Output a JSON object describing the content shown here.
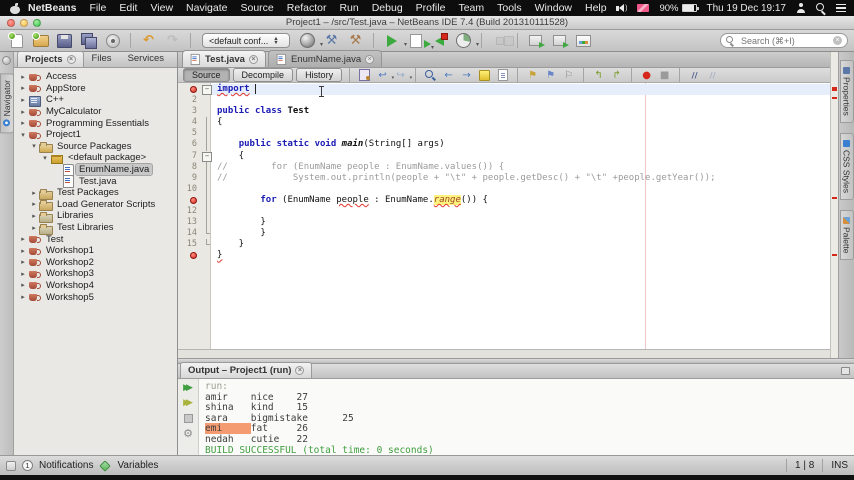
{
  "colors": {
    "error_red": "#e1352b",
    "error_highlight_yellow": "#fdf27b",
    "success_green": "#3f9e3f",
    "output_match_orange": "#f49b72",
    "keyword_blue": "#1a1ab5",
    "comment_gray": "#9b9b9b"
  },
  "menubar": {
    "items": [
      "NetBeans",
      "File",
      "Edit",
      "View",
      "Navigate",
      "Source",
      "Refactor",
      "Run",
      "Debug",
      "Profile",
      "Team",
      "Tools",
      "Window",
      "Help"
    ],
    "battery_percent": "90%",
    "clock": "Thu 19 Dec 19:17"
  },
  "window": {
    "title": "Project1 – /src/Test.java – NetBeans IDE 7.4 (Build 201310111528)"
  },
  "toolbar": {
    "config_label": "<default conf...",
    "search_placeholder": "Search (⌘+I)",
    "buttons": [
      {
        "name": "new-file",
        "cls": "i-new-file"
      },
      {
        "name": "new-project",
        "cls": "i-new-project"
      },
      {
        "name": "open-project",
        "cls": "i-open-project"
      },
      {
        "name": "save-all",
        "cls": "i-save-all"
      },
      {
        "name": "open-file",
        "cls": "i-open-file"
      },
      {
        "sep": true
      },
      {
        "name": "undo",
        "glyph": "↶",
        "color": "#dd9a2e"
      },
      {
        "name": "redo",
        "glyph": "↷",
        "color": "#bcbcbc"
      },
      {
        "sep": true
      },
      {
        "config": true
      },
      {
        "name": "build-with-dependencies",
        "cls": "i-sphere",
        "dd": true
      },
      {
        "name": "build-project",
        "glyph": "⚒",
        "color": "#5b78a8"
      },
      {
        "name": "clean-and-build",
        "glyph": "⚒",
        "color": "#a8784a"
      },
      {
        "sep": true
      },
      {
        "name": "run-project",
        "cls": "i-run",
        "dd": true
      },
      {
        "name": "debug-project",
        "cls": "i-debug",
        "dd": true
      },
      {
        "name": "apply-code-changes",
        "cls": "i-apply"
      },
      {
        "name": "profile-project",
        "cls": "i-profile",
        "dd": true
      },
      {
        "sep": true
      },
      {
        "name": "profiling-points",
        "cls": "i-ppoints",
        "dis": true
      },
      {
        "sep": true
      },
      {
        "name": "vcs-update",
        "cls": "i-vcs"
      },
      {
        "name": "vcs-commit",
        "cls": "i-vcs"
      },
      {
        "name": "memory-view",
        "cls": "i-mem"
      }
    ]
  },
  "left_rail": {
    "tab": "Navigator"
  },
  "right_rail": {
    "tabs": [
      {
        "label": "Properties",
        "icon": "props"
      },
      {
        "label": "CSS Styles",
        "icon": "css"
      },
      {
        "label": "Palette",
        "icon": "palette"
      }
    ]
  },
  "projects": {
    "tabs": [
      {
        "label": "Projects",
        "active": true,
        "closable": true
      },
      {
        "label": "Files"
      },
      {
        "label": "Services"
      }
    ],
    "tree": [
      {
        "d": 0,
        "a": "c",
        "i": "prj",
        "l": "Access"
      },
      {
        "d": 0,
        "a": "c",
        "i": "prj",
        "l": "AppStore"
      },
      {
        "d": 0,
        "a": "c",
        "i": "cpp",
        "l": "C++"
      },
      {
        "d": 0,
        "a": "c",
        "i": "prj",
        "l": "MyCalculator"
      },
      {
        "d": 0,
        "a": "c",
        "i": "prj",
        "l": "Programming Essentials"
      },
      {
        "d": 0,
        "a": "e",
        "i": "prj",
        "l": "Project1"
      },
      {
        "d": 1,
        "a": "e",
        "i": "src",
        "l": "Source Packages"
      },
      {
        "d": 2,
        "a": "e",
        "i": "pkg",
        "l": "<default package>"
      },
      {
        "d": 3,
        "a": "n",
        "i": "jav",
        "l": "EnumName.java",
        "sel": true
      },
      {
        "d": 3,
        "a": "n",
        "i": "jav",
        "l": "Test.java"
      },
      {
        "d": 1,
        "a": "c",
        "i": "folder",
        "l": "Test Packages"
      },
      {
        "d": 1,
        "a": "c",
        "i": "folder",
        "l": "Load Generator Scripts"
      },
      {
        "d": 1,
        "a": "c",
        "i": "lib",
        "l": "Libraries"
      },
      {
        "d": 1,
        "a": "c",
        "i": "lib",
        "l": "Test Libraries"
      },
      {
        "d": 0,
        "a": "c",
        "i": "prj",
        "l": "Test"
      },
      {
        "d": 0,
        "a": "c",
        "i": "prj",
        "l": "Workshop1"
      },
      {
        "d": 0,
        "a": "c",
        "i": "prj",
        "l": "Workshop2"
      },
      {
        "d": 0,
        "a": "c",
        "i": "prj",
        "l": "Workshop3"
      },
      {
        "d": 0,
        "a": "c",
        "i": "prj",
        "l": "Workshop4"
      },
      {
        "d": 0,
        "a": "c",
        "i": "prj",
        "l": "Workshop5"
      }
    ]
  },
  "editor": {
    "tabs": [
      {
        "label": "Test.java",
        "active": true
      },
      {
        "label": "EnumName.java",
        "active": false
      }
    ],
    "views": [
      {
        "label": "Source",
        "pressed": true
      },
      {
        "label": "Decompile"
      },
      {
        "label": "History"
      }
    ],
    "toolbar_icons": [
      {
        "name": "last-edited-icon",
        "cls": "i-lastedit"
      },
      {
        "name": "back-icon",
        "glyph": "↩",
        "color": "#4a78c0",
        "dd": true
      },
      {
        "name": "forward-icon",
        "glyph": "↪",
        "color": "#93a9c9",
        "dd": true
      },
      {
        "sep": true
      },
      {
        "name": "find-selection-icon",
        "cls": "i-mag"
      },
      {
        "name": "find-next-icon",
        "glyph": "←",
        "color": "#4a78c0"
      },
      {
        "name": "find-previous-icon",
        "glyph": "→",
        "color": "#4a78c0"
      },
      {
        "name": "toggle-highlight-icon",
        "cls": "i-hl"
      },
      {
        "name": "select-occurrences-icon",
        "cls": "i-page"
      },
      {
        "sep": true
      },
      {
        "name": "previous-bookmark-icon",
        "glyph": "⚑",
        "color": "#c9a23a"
      },
      {
        "name": "next-bookmark-icon",
        "glyph": "⚑",
        "color": "#6a86c9"
      },
      {
        "name": "toggle-bookmark-icon",
        "glyph": "⚐",
        "color": "#8a8a8a"
      },
      {
        "sep": true
      },
      {
        "name": "shift-left-icon",
        "glyph": "↰",
        "color": "#7a9b2d"
      },
      {
        "name": "shift-right-icon",
        "glyph": "↱",
        "color": "#7a9b2d"
      },
      {
        "sep": true
      },
      {
        "name": "record-macro-icon",
        "glyph": "●",
        "color": "#d5281b"
      },
      {
        "name": "stop-macro-icon",
        "glyph": "■",
        "color": "#9a9a9a"
      },
      {
        "sep": true
      },
      {
        "name": "comment-icon",
        "cls": "i-cmt"
      },
      {
        "name": "uncomment-icon",
        "cls": "i-cmt2"
      }
    ],
    "code": {
      "lines": [
        {
          "ln": "1",
          "cur": true,
          "badge": "err",
          "fold": "box",
          "caret": true,
          "tok": [
            [
              "ku",
              "import"
            ],
            [
              "p",
              " "
            ]
          ]
        },
        {
          "ln": "2",
          "tok": []
        },
        {
          "ln": "3",
          "tok": [
            [
              "k",
              "public"
            ],
            [
              "p",
              " "
            ],
            [
              "k",
              "class"
            ],
            [
              "p",
              " "
            ],
            [
              "b",
              "Test"
            ]
          ]
        },
        {
          "ln": "4",
          "fold": "v",
          "tok": [
            [
              "p",
              "{"
            ]
          ]
        },
        {
          "ln": "5",
          "fold": "v",
          "tok": []
        },
        {
          "ln": "6",
          "fold": "v",
          "tok": [
            [
              "p",
              "    "
            ],
            [
              "k",
              "public"
            ],
            [
              "p",
              " "
            ],
            [
              "k",
              "static"
            ],
            [
              "p",
              " "
            ],
            [
              "k",
              "void"
            ],
            [
              "p",
              " "
            ],
            [
              "bi",
              "main"
            ],
            [
              "p",
              "(String[] args)"
            ]
          ]
        },
        {
          "ln": "7",
          "fold": "box",
          "tok": [
            [
              "p",
              "    {"
            ]
          ]
        },
        {
          "ln": "8",
          "fold": "v",
          "tok": [
            [
              "c",
              "//        for (EnumName people : EnumName.values()) {"
            ]
          ]
        },
        {
          "ln": "9",
          "fold": "v",
          "tok": [
            [
              "c",
              "//            System.out.println(people + \"\\t\" + people.getDesc() + \"\\t\" +people.getYear());"
            ]
          ]
        },
        {
          "ln": "10",
          "fold": "v",
          "tok": []
        },
        {
          "ln": "11",
          "badge": "err",
          "fold": "v",
          "tok": [
            [
              "p",
              "        "
            ],
            [
              "k",
              "for"
            ],
            [
              "p",
              " (EnumName "
            ],
            [
              "eu",
              "people"
            ],
            [
              "p",
              " : EnumName."
            ],
            [
              "rg",
              "range"
            ],
            [
              "p",
              "()) {"
            ]
          ]
        },
        {
          "ln": "12",
          "fold": "v",
          "tok": []
        },
        {
          "ln": "13",
          "fold": "v",
          "tok": [
            [
              "p",
              "        }"
            ]
          ]
        },
        {
          "ln": "14",
          "fold": "c",
          "tok": [
            [
              "p",
              "        }"
            ]
          ]
        },
        {
          "ln": "15",
          "fold": "c",
          "tok": [
            [
              "p",
              "    }"
            ]
          ]
        },
        {
          "ln": "16",
          "badge": "err",
          "tok": [
            [
              "eu",
              "}"
            ]
          ]
        }
      ]
    }
  },
  "output": {
    "tab": "Output – Project1 (run)",
    "rail": [
      {
        "name": "rerun",
        "cls": "or-run",
        "glyph": "▶▶"
      },
      {
        "name": "rerun-with-profiling",
        "cls": "or-run2",
        "glyph": "▶▶"
      },
      {
        "name": "stop-build",
        "cls": "or-stop",
        "glyph": ""
      },
      {
        "name": "ant-settings",
        "cls": "or-set",
        "glyph": "⚙"
      }
    ],
    "lines": [
      {
        "t": [
          [
            "run",
            "run:"
          ]
        ]
      },
      {
        "t": [
          [
            "out",
            "amir    nice    27"
          ]
        ]
      },
      {
        "t": [
          [
            "out",
            "shina   kind    15"
          ]
        ]
      },
      {
        "t": [
          [
            "out",
            "sara    bigmistake      25"
          ]
        ]
      },
      {
        "t": [
          [
            "hl",
            "emi     "
          ],
          [
            "out",
            "fat     26"
          ]
        ]
      },
      {
        "t": [
          [
            "out",
            "nedah   cutie   22"
          ]
        ]
      },
      {
        "t": [
          [
            "ok",
            "BUILD SUCCESSFUL (total time: 0 seconds)"
          ]
        ]
      }
    ]
  },
  "statusbar": {
    "notification_count": "1",
    "notifications_label": "Notifications",
    "variables_label": "Variables",
    "caret_position": "1 | 8",
    "insert_mode": "INS"
  }
}
